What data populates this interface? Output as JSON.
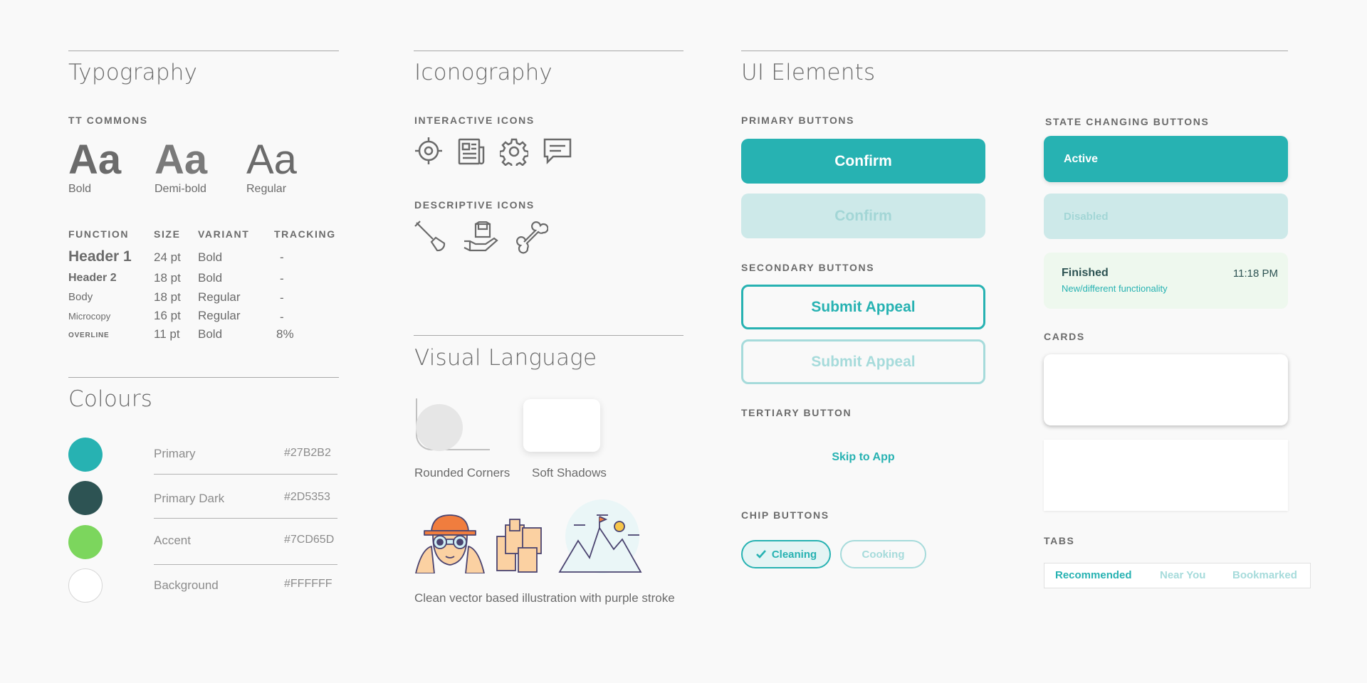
{
  "typography": {
    "title": "Typography",
    "font_name": "TT COMMONS",
    "weights": [
      {
        "sample": "Aa",
        "label": "Bold"
      },
      {
        "sample": "Aa",
        "label": "Demi-bold"
      },
      {
        "sample": "Aa",
        "label": "Regular"
      }
    ],
    "headers": {
      "function": "FUNCTION",
      "size": "SIZE",
      "variant": "VARIANT",
      "tracking": "TRACKING"
    },
    "rows": [
      {
        "function": "Header 1",
        "size": "24 pt",
        "variant": "Bold",
        "tracking": "-"
      },
      {
        "function": "Header 2",
        "size": "18 pt",
        "variant": "Bold",
        "tracking": "-"
      },
      {
        "function": "Body",
        "size": "18 pt",
        "variant": "Regular",
        "tracking": "-"
      },
      {
        "function": "Microcopy",
        "size": "16 pt",
        "variant": "Regular",
        "tracking": "-"
      },
      {
        "function": "OVERLINE",
        "size": "11 pt",
        "variant": "Bold",
        "tracking": "8%"
      }
    ]
  },
  "colours": {
    "title": "Colours",
    "items": [
      {
        "name": "Primary",
        "hex": "#27B2B2",
        "color": "#27B2B2"
      },
      {
        "name": "Primary Dark",
        "hex": "#2D5353",
        "color": "#2D5353"
      },
      {
        "name": "Accent",
        "hex": "#7CD65D",
        "color": "#7CD65D"
      },
      {
        "name": "Background",
        "hex": "#FFFFFF",
        "color": "#FFFFFF"
      }
    ]
  },
  "iconography": {
    "title": "Iconography",
    "interactive_label": "INTERACTIVE ICONS",
    "interactive_icons": [
      "target-icon",
      "newspaper-icon",
      "gear-icon",
      "chat-icon"
    ],
    "descriptive_label": "DESCRIPTIVE ICONS",
    "descriptive_icons": [
      "shovel-icon",
      "package-hand-icon",
      "bone-icon"
    ]
  },
  "visual_language": {
    "title": "Visual Language",
    "rounded_corners": "Rounded Corners",
    "soft_shadows": "Soft Shadows",
    "illustration_caption": "Clean vector based illustration with purple stroke"
  },
  "ui_elements": {
    "title": "UI Elements",
    "primary_label": "PRIMARY BUTTONS",
    "primary_button": "Confirm",
    "primary_button_disabled": "Confirm",
    "secondary_label": "SECONDARY BUTTONS",
    "secondary_button": "Submit Appeal",
    "secondary_button_disabled": "Submit Appeal",
    "tertiary_label": "TERTIARY BUTTON",
    "tertiary_button": "Skip to App",
    "chip_label": "CHIP BUTTONS",
    "chips": [
      {
        "label": "Cleaning",
        "selected": true
      },
      {
        "label": "Cooking",
        "selected": false
      }
    ],
    "state_label": "STATE CHANGING BUTTONS",
    "state_active": "Active",
    "state_disabled": "Disabled",
    "state_finished": {
      "title": "Finished",
      "time": "11:18 PM",
      "subtitle": "New/different functionality"
    },
    "cards_label": "CARDS",
    "tabs_label": "TABS",
    "tabs": [
      "Recommended",
      "Near You",
      "Bookmarked"
    ]
  },
  "colors": {
    "primary": "#27B2B2",
    "primary_dark": "#2D5353",
    "accent": "#7CD65D",
    "background": "#F9F9F9"
  }
}
